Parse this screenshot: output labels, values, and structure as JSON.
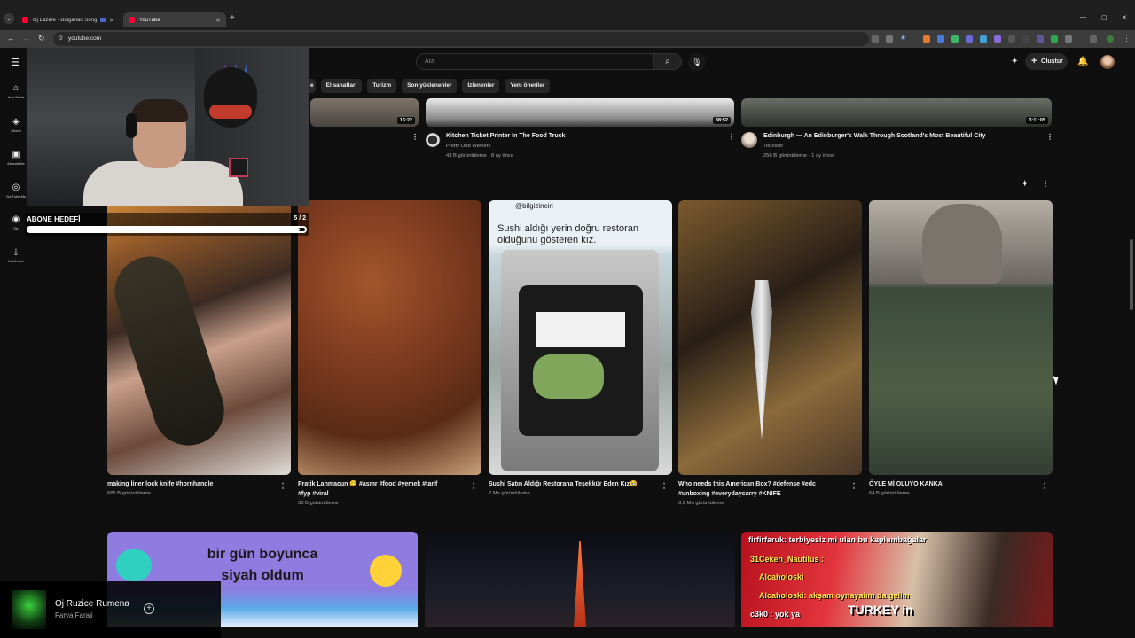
{
  "browser": {
    "tabs": [
      {
        "title": "Oj Lazare - Bulgarian Song",
        "active": false
      },
      {
        "title": "YouTube",
        "active": true
      }
    ],
    "url": "youtube.com"
  },
  "masthead": {
    "search_placeholder": "Ara",
    "create_label": "Oluştur"
  },
  "chips": [
    "e",
    "El sanatları",
    "Turizm",
    "Son yüklenenler",
    "İzlenenler",
    "Yeni öneriler"
  ],
  "sidebar": {
    "items": [
      {
        "icon": "home-icon",
        "label": "Ana Sayfa"
      },
      {
        "icon": "shorts-icon",
        "label": "Shorts"
      },
      {
        "icon": "subscriptions-icon",
        "label": "Abonelikler"
      },
      {
        "icon": "youtube-music-icon",
        "label": "YouTube Mu"
      },
      {
        "icon": "you-icon",
        "label": "Siz"
      },
      {
        "icon": "download-icon",
        "label": "İndirilenler"
      }
    ]
  },
  "overlay": {
    "goal_title": "ABONE HEDEFİ",
    "goal_count": "5 / 2",
    "goal_progress": 0.98
  },
  "top_videos": [
    {
      "duration": "16:22"
    },
    {
      "duration": "38:52",
      "title": "Kitchen Ticket Printer In The Food Truck",
      "channel": "Pretty Odd Wieners",
      "meta": "43 B görüntüleme · 8 ay önce"
    },
    {
      "duration": "3:11:05",
      "title": "Edinburgh — An Edinburger's Walk Through Scotland's Most Beautiful City",
      "channel": "Tourister",
      "meta": "256 B görüntüleme · 1 ay önce"
    }
  ],
  "shorts": [
    {
      "title_lines": [
        "making liner lock knife #hornhandle"
      ],
      "views": "665 B görüntüleme"
    },
    {
      "title_lines": [
        "Pratik Lahmacun 😋 #asmr #food #yemek #tarif",
        "#fyp #viral"
      ],
      "views": "30 B görüntüleme"
    },
    {
      "title_lines": [
        "Sushi Satın Aldığı Restorana Teşekkür Eden Kız🥹"
      ],
      "views": "2 Mn görüntüleme",
      "overlay_handle": "@bilgizinciri",
      "overlay_caption": "Sushi aldığı yerin doğru restoran olduğunu gösteren kız."
    },
    {
      "title_lines": [
        "Who needs this American Box? #defense #edc",
        "#unboxing #everydaycarry #KNIFE"
      ],
      "views": "3,2 Mn görüntüleme"
    },
    {
      "title_lines": [
        "ÖYLE Mİ OLUYO KANKA"
      ],
      "views": "64 B görüntüleme"
    }
  ],
  "bottom_videos": [
    {
      "caption": "bir gün boyunca siyah oldum"
    },
    {
      "caption": ""
    },
    {
      "chat": [
        "firfirfaruk: terbiyesiz mi ulan bu kaplumbağalar",
        "31Ceken_Nautilus :",
        "Alcaholoski",
        "Alcaholoski: akşam oynayalım da gelim",
        "c3k0 : yok ya",
        "TURKEY in"
      ]
    }
  ],
  "music_player": {
    "title": "Oj Ruzice Rumena",
    "artist": "Farya Faraji"
  },
  "colors": {
    "background": "#0f0f0f",
    "brand_red": "#ff0033",
    "chip_bg": "#272727"
  }
}
